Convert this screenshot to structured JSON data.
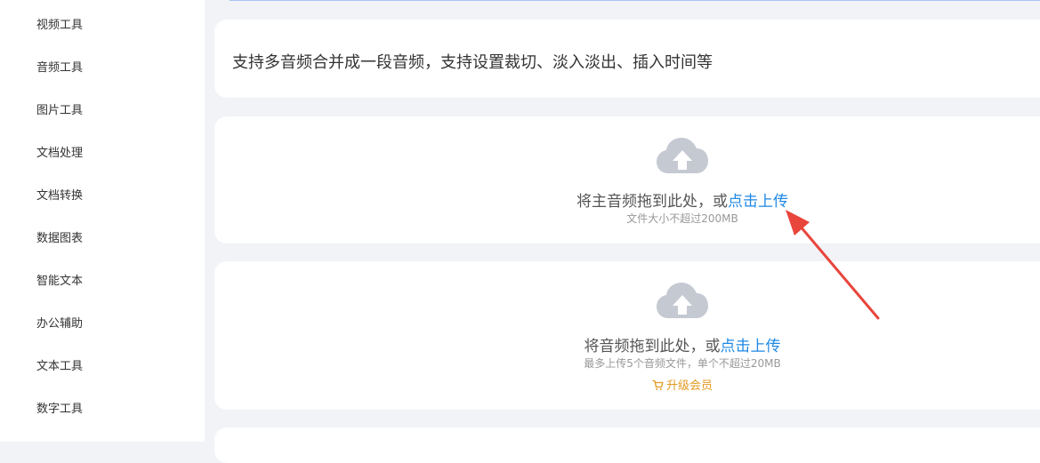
{
  "sidebar": {
    "items": [
      {
        "label": "视频工具"
      },
      {
        "label": "音频工具"
      },
      {
        "label": "图片工具"
      },
      {
        "label": "文档处理"
      },
      {
        "label": "文档转换"
      },
      {
        "label": "数据图表"
      },
      {
        "label": "智能文本"
      },
      {
        "label": "办公辅助"
      },
      {
        "label": "文本工具"
      },
      {
        "label": "数字工具"
      }
    ]
  },
  "main": {
    "description": "支持多音频合并成一段音频，支持设置裁切、淡入淡出、插入时间等",
    "main_upload": {
      "text": "将主音频拖到此处，或",
      "link": "点击上传",
      "hint": "文件大小不超过200MB"
    },
    "audio_upload": {
      "text": "将音频拖到此处，或",
      "link": "点击上传",
      "hint": "最多上传5个音频文件，单个不超过20MB",
      "upgrade": "升级会员"
    }
  },
  "colors": {
    "accent": "#1e88e5",
    "upgrade": "#e39a1f",
    "annotation_arrow": "#e8453c",
    "cloud": "#c5c9d2"
  },
  "icons": {
    "upload": "cloud-upload-icon",
    "cart": "shopping-cart-icon",
    "annotation": "red-arrow"
  }
}
